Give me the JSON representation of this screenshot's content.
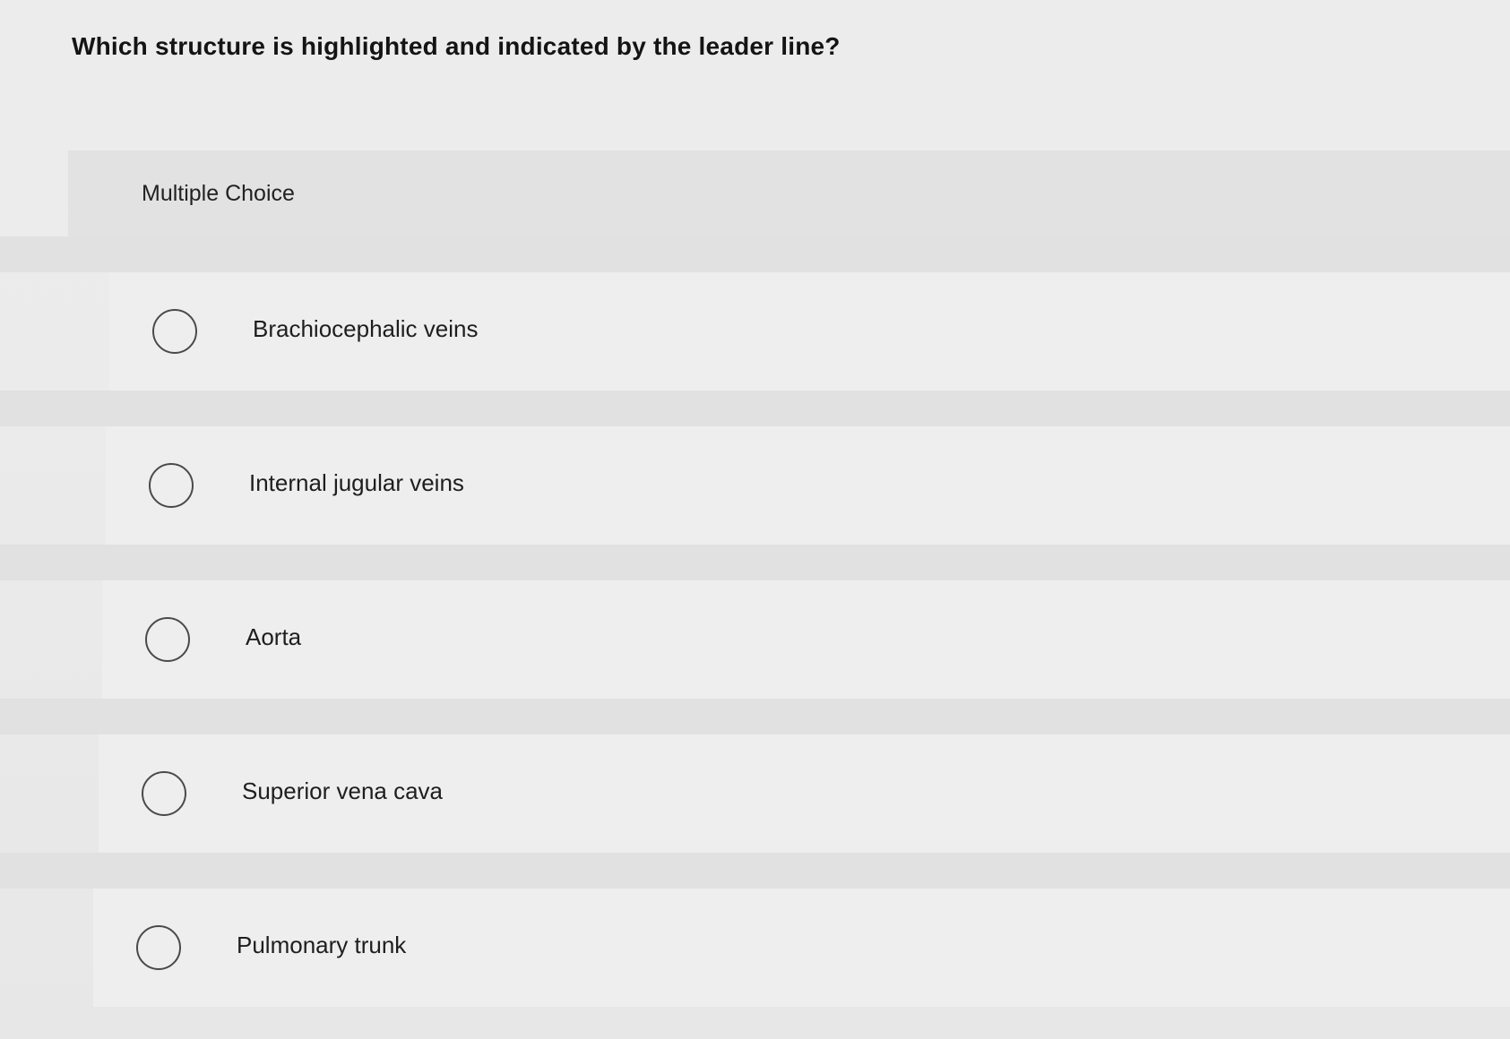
{
  "question": {
    "text": "Which structure is highlighted and indicated by the leader line?"
  },
  "section": {
    "label": "Multiple Choice"
  },
  "options": [
    {
      "label": "Brachiocephalic veins",
      "selected": false
    },
    {
      "label": "Internal jugular veins",
      "selected": false
    },
    {
      "label": "Aorta",
      "selected": false
    },
    {
      "label": "Superior vena cava",
      "selected": false
    },
    {
      "label": "Pulmonary trunk",
      "selected": false
    }
  ]
}
